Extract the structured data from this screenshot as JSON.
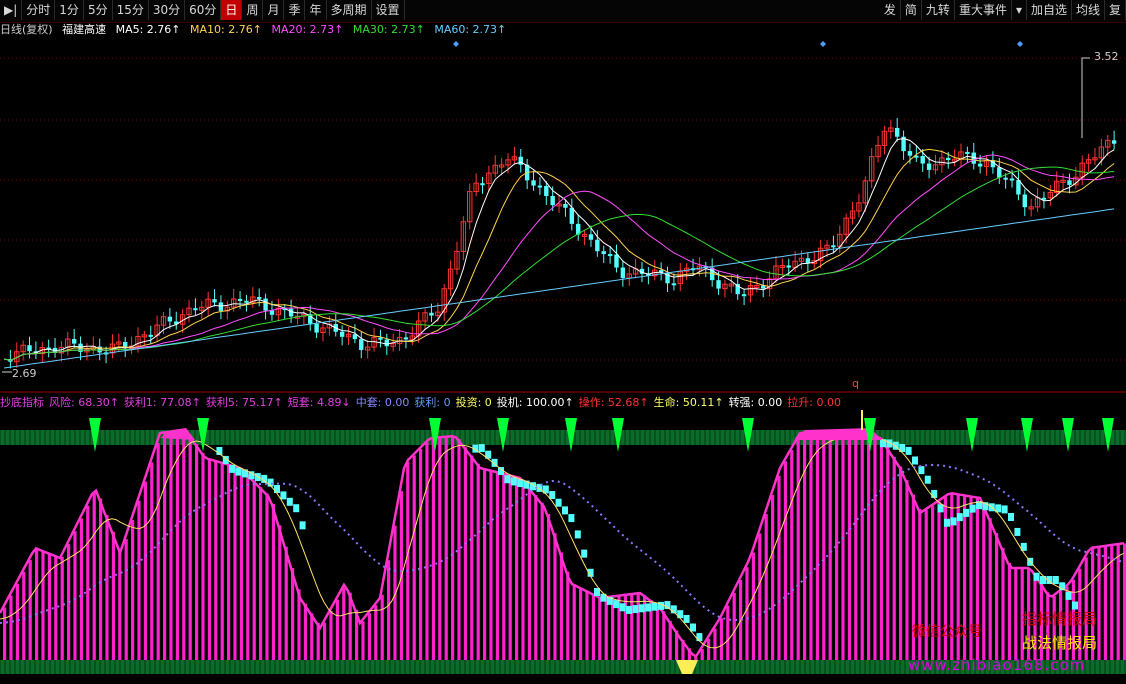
{
  "toolbar": {
    "left": [
      {
        "label": "▶|",
        "active": false
      },
      {
        "label": "分时",
        "active": false
      },
      {
        "label": "1分",
        "active": false
      },
      {
        "label": "5分",
        "active": false
      },
      {
        "label": "15分",
        "active": false
      },
      {
        "label": "30分",
        "active": false
      },
      {
        "label": "60分",
        "active": false
      },
      {
        "label": "日",
        "active": true
      },
      {
        "label": "周",
        "active": false
      },
      {
        "label": "月",
        "active": false
      },
      {
        "label": "季",
        "active": false
      },
      {
        "label": "年",
        "active": false
      },
      {
        "label": "多周期",
        "active": false
      },
      {
        "label": "设置",
        "active": false
      }
    ],
    "right": [
      "发",
      "简",
      "九转",
      "重大事件",
      "加自选",
      "均线",
      "复"
    ]
  },
  "main_info": {
    "period": "日线(复权)",
    "stock": "福建高速",
    "ma": [
      {
        "label": "MA5: 2.76↑",
        "color": "#ffffff"
      },
      {
        "label": "MA10: 2.76↑",
        "color": "#ffd24d"
      },
      {
        "label": "MA20: 2.73↑",
        "color": "#ff4dff"
      },
      {
        "label": "MA30: 2.73↑",
        "color": "#33dd33"
      },
      {
        "label": "MA60: 2.73↑",
        "color": "#66ccff"
      }
    ]
  },
  "price_labels": {
    "high": "3.52",
    "low": "2.69",
    "marker": "q"
  },
  "indicator_info": [
    {
      "text": "抄底指标",
      "color": "#e040e0"
    },
    {
      "text": "风险: 68.30↑",
      "color": "#e040e0"
    },
    {
      "text": "获利1: 77.08↑",
      "color": "#e040e0"
    },
    {
      "text": "获利5: 75.17↑",
      "color": "#e040e0"
    },
    {
      "text": "短套: 4.89↓",
      "color": "#e040e0"
    },
    {
      "text": "中套: 0.00",
      "color": "#8888ff"
    },
    {
      "text": "获利: 0",
      "color": "#6699ff"
    },
    {
      "text": "投资: 0",
      "color": "#ffff66"
    },
    {
      "text": "投机: 100.00↑",
      "color": "#ffffff"
    },
    {
      "text": "操作: 52.68↑",
      "color": "#ff3333"
    },
    {
      "text": "生命: 50.11↑",
      "color": "#ffff66"
    },
    {
      "text": "转强: 0.00",
      "color": "#ffffff"
    },
    {
      "text": "拉升: 0.00",
      "color": "#ff3333"
    }
  ],
  "watermark": {
    "left": "微信公众号",
    "right1": "指标情报局",
    "right2": "战法情报局",
    "url": "www.zhibiao168.com"
  },
  "chart_data": {
    "type": "candlestick",
    "price_high": 3.52,
    "price_low": 2.69,
    "indicator_range": [
      0,
      100
    ],
    "colors": {
      "up": "#ff3333",
      "down": "#54ffff",
      "ma5": "#ffffff",
      "ma10": "#ffd24d",
      "ma20": "#ff4dff",
      "ma30": "#33dd33",
      "ma60": "#66ccff",
      "risk": "#ff22cc",
      "bar": "#ff22cc",
      "signal": "#00ff33",
      "grid": "#7a0000"
    }
  }
}
